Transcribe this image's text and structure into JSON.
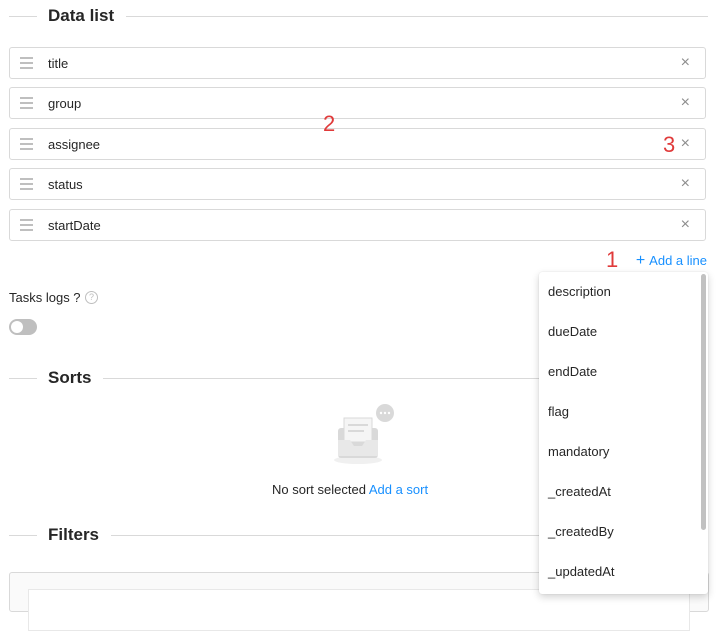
{
  "data_list": {
    "title": "Data list",
    "fields": [
      {
        "label": "title",
        "remove": "×"
      },
      {
        "label": "group",
        "remove": "×"
      },
      {
        "label": "assignee",
        "remove": "×"
      },
      {
        "label": "status",
        "remove": "×"
      },
      {
        "label": "startDate",
        "remove": "×"
      }
    ],
    "add_line": "Add a line"
  },
  "annotations": [
    "1",
    "2",
    "3"
  ],
  "tasks_logs": {
    "label": "Tasks logs ?",
    "help": "?",
    "enabled": false
  },
  "sorts": {
    "title": "Sorts",
    "empty_text": "No sort selected",
    "add_link": "Add a sort"
  },
  "filters": {
    "title": "Filters"
  },
  "dropdown": {
    "options": [
      "description",
      "dueDate",
      "endDate",
      "flag",
      "mandatory",
      "_createdAt",
      "_createdBy",
      "_updatedAt"
    ]
  },
  "colors": {
    "accent": "#1890ff",
    "annotation": "#e03a3a",
    "border": "#d9d9d9"
  }
}
